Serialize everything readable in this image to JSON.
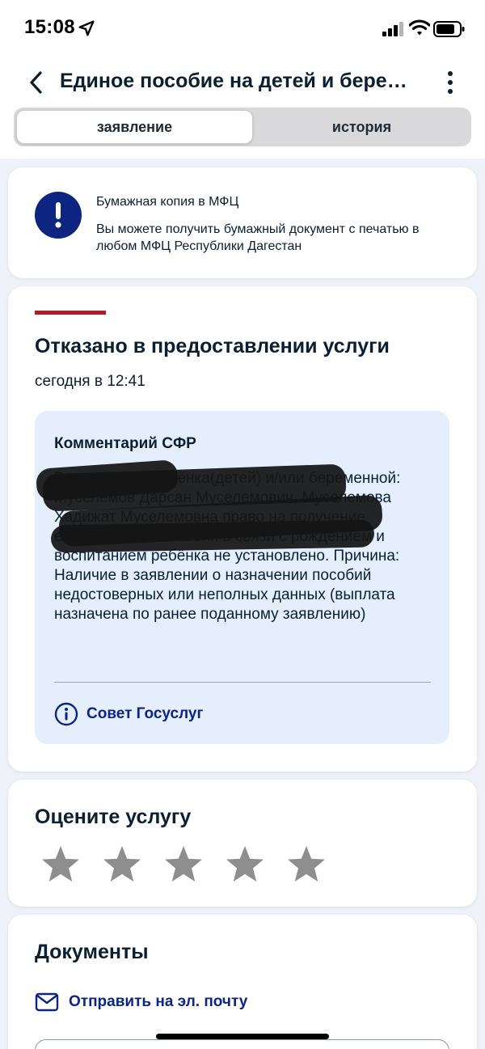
{
  "status_bar": {
    "time": "15:08"
  },
  "header": {
    "title": "Единое пособие на детей и бере…"
  },
  "tabs": [
    {
      "label": "заявление",
      "active": true
    },
    {
      "label": "история",
      "active": false
    }
  ],
  "mfc_card": {
    "title": "Бумажная копия в МФЦ",
    "text": "Вы можете получить бумажный документ с печатью в любом МФЦ Республики Дагестан"
  },
  "status_card": {
    "title": "Отказано в предоставлении услуги",
    "date": "сегодня в 12:41",
    "comment_title": "Комментарий СФР",
    "comment_text": "В отношении ребёнка(детей) и/или беременной: Муселемов Дарсан Муселемович, Муселемова Хадижат Муселемовна право на получение ежемесячного пособия в связи с рождением и воспитанием ребёнка не установлено. Причина: Наличие в заявлении о назначении пособий недостоверных или неполных данных (выплата назначена по ранее поданному заявлению)",
    "advice_label": "Совет Госуслуг",
    "accent_color": "#b01c2e"
  },
  "rating": {
    "title": "Оцените услугу",
    "stars_total": 5,
    "stars_selected": 0
  },
  "documents": {
    "title": "Документы",
    "email_label": "Отправить на эл. почту"
  },
  "colors": {
    "brand_blue": "#0d2580",
    "text": "#0b1f33",
    "comment_bg": "#e4eefc",
    "star_gray": "#8e8e8e"
  },
  "icons": [
    "location-arrow-icon",
    "signal-icon",
    "wifi-icon",
    "battery-icon",
    "back-chevron-icon",
    "more-vertical-icon",
    "exclamation-icon",
    "info-icon",
    "star-icon",
    "envelope-icon"
  ]
}
